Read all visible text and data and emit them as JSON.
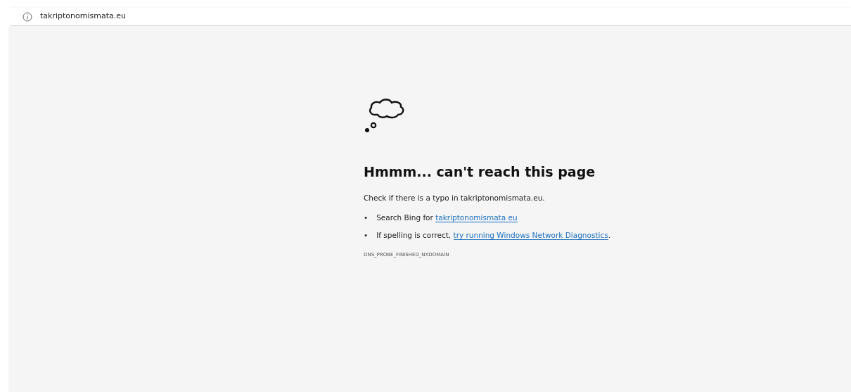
{
  "address_bar": {
    "url": "takriptonomismata.eu"
  },
  "error": {
    "title": "Hmmm... can't reach this page",
    "message": "Check if there is a typo in takriptonomismata.eu.",
    "suggestions": [
      {
        "bullet": "•",
        "text_before": "Search Bing for ",
        "link": "takriptonomismata eu"
      },
      {
        "bullet": "•",
        "text_before": "If spelling is correct, ",
        "link": "try running Windows Network Diagnostics",
        "text_after": "."
      }
    ],
    "code": "DNS_PROBE_FINISHED_NXDOMAIN"
  }
}
